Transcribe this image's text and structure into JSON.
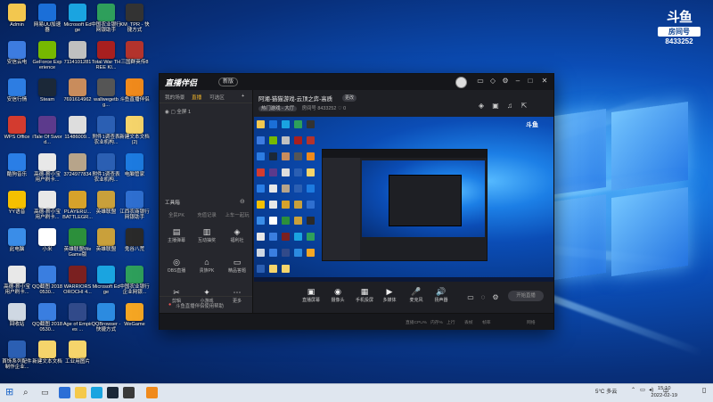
{
  "desktop_icons": [
    {
      "label": "Admin",
      "color": "#f3c74f"
    },
    {
      "label": "网易UU加速器",
      "color": "#1b6fd8"
    },
    {
      "label": "Microsoft Edge",
      "color": "#1aa4e0"
    },
    {
      "label": "中国农业银行网银助手",
      "color": "#2e9f5b"
    },
    {
      "label": "KM_TPR - 快捷方式",
      "color": "#333333"
    },
    {
      "label": "安信云电",
      "color": "#3d7ce0"
    },
    {
      "label": "GeForce Experience",
      "color": "#76b900"
    },
    {
      "label": "7114101281",
      "color": "#c0c0c0"
    },
    {
      "label": "Total War THREE KI...",
      "color": "#a81f1f"
    },
    {
      "label": "三国群英传8",
      "color": "#b3332c"
    },
    {
      "label": "安信行情",
      "color": "#2d7de2"
    },
    {
      "label": "Steam",
      "color": "#1b2838"
    },
    {
      "label": "7691614962",
      "color": "#c98c5c"
    },
    {
      "label": "wallwegetbg...",
      "color": "#555555"
    },
    {
      "label": "斗鱼直播伴侣",
      "color": "#f08a1c"
    },
    {
      "label": "WPS Office",
      "color": "#d33b2f"
    },
    {
      "label": "iTale Of Sword...",
      "color": "#5c3a8c"
    },
    {
      "label": "11486009...",
      "color": "#dddddd"
    },
    {
      "label": "附件1调查表农业机构...",
      "color": "#2b5fb3"
    },
    {
      "label": "新建文本文档 (2)",
      "color": "#f5d46b"
    },
    {
      "label": "酷狗音乐",
      "color": "#2a7ee6"
    },
    {
      "label": "高德-薪小宝用户刷卡...",
      "color": "#e8e8e8"
    },
    {
      "label": "3724977834",
      "color": "#b7a48a"
    },
    {
      "label": "附件1调查表农业机构...",
      "color": "#2b5fb3"
    },
    {
      "label": "电脑管家",
      "color": "#1d7be0"
    },
    {
      "label": "YY语音",
      "color": "#f5c000"
    },
    {
      "label": "高德-薪小宝用户刷卡...",
      "color": "#e8e8e8"
    },
    {
      "label": "PLAYERU... BATTLEGR...",
      "color": "#d6a22b"
    },
    {
      "label": "英雄联盟",
      "color": "#c9a03b"
    },
    {
      "label": "江西农商银行网银助手",
      "color": "#2f6fd0"
    },
    {
      "label": "此电脑",
      "color": "#3a8de8"
    },
    {
      "label": "小米",
      "color": "#ffffff"
    },
    {
      "label": "英雄联盟WeGame版",
      "color": "#2c8f3b"
    },
    {
      "label": "英雄联盟",
      "color": "#c9a03b"
    },
    {
      "label": "鬼谷八荒",
      "color": "#2a2a2a"
    },
    {
      "label": "高德-薪小宝用户刷卡...",
      "color": "#e8e8e8"
    },
    {
      "label": "QQ截图 20180530...",
      "color": "#3a7ee0"
    },
    {
      "label": "WARRIORS OROCHI 4...",
      "color": "#7a2020"
    },
    {
      "label": "Microsoft Edge",
      "color": "#1aa4e0"
    },
    {
      "label": "中国农业银行企业网银...",
      "color": "#2e9f5b"
    },
    {
      "label": "回收站",
      "color": "#cfd8e3"
    },
    {
      "label": "QQ截图 20180530...",
      "color": "#3a7ee0"
    },
    {
      "label": "Age of Empires ...",
      "color": "#314a8a"
    },
    {
      "label": "QQBrowser - 快捷方式",
      "color": "#2c8be0"
    },
    {
      "label": "WeGame",
      "color": "#f5a623"
    },
    {
      "label": "首饰系列配件制作企业...",
      "color": "#2b5fb3"
    },
    {
      "label": "新建文本文档",
      "color": "#f5d46b"
    },
    {
      "label": "工业用图片",
      "color": "#f5d46b"
    }
  ],
  "watermark": {
    "logo": "斗鱼",
    "sub": "房间号",
    "room": "8433252"
  },
  "app": {
    "brand": "直播伴侣",
    "version": "新版",
    "left_tabs": [
      "我的场景",
      "直播",
      "可选区"
    ],
    "left_active": 1,
    "scene_label": "全屏 1",
    "section_label": "工具箱",
    "rows": [
      [
        "全民PK",
        "充值记录",
        "上车一起玩"
      ]
    ],
    "tools": [
      {
        "icon": "▤",
        "label": "主播弹幕"
      },
      {
        "icon": "▥",
        "label": "互动抽奖"
      },
      {
        "icon": "◈",
        "label": "福利社"
      },
      {
        "icon": "◎",
        "label": "OBS直播"
      },
      {
        "icon": "⌂",
        "label": "贵族PK"
      },
      {
        "icon": "▭",
        "label": "精品答题"
      },
      {
        "icon": "✂",
        "label": "剪辑"
      },
      {
        "icon": "✦",
        "label": "小游戏"
      },
      {
        "icon": "⋯",
        "label": "更多"
      }
    ],
    "footer_text": "斗鱼直播伴侣使用帮助",
    "room_title": "阿湘-猫猫游戏-云顶之弈-高质",
    "room_badge": "更改",
    "room_tag": "热门游戏 - 大厅",
    "room_id_label": "房间号",
    "room_id": "8433252",
    "fans": "0",
    "bottom_buttons": [
      {
        "icon": "▣",
        "label": "直播屏幕"
      },
      {
        "icon": "◉",
        "label": "摄像头"
      },
      {
        "icon": "▦",
        "label": "手机投屏"
      },
      {
        "icon": "▶",
        "label": "多媒体"
      },
      {
        "icon": "🎤",
        "label": "麦克风"
      },
      {
        "icon": "🔊",
        "label": "扬声器"
      }
    ],
    "start_label": "开始直播",
    "status_right": [
      "直播CPU%",
      "内存%",
      "上行",
      "丢帧",
      "帧率",
      "网络"
    ]
  },
  "taskbar": {
    "weather": "5°C 多云",
    "time": "15:10",
    "date": "2022-02-19",
    "lang": "中"
  }
}
